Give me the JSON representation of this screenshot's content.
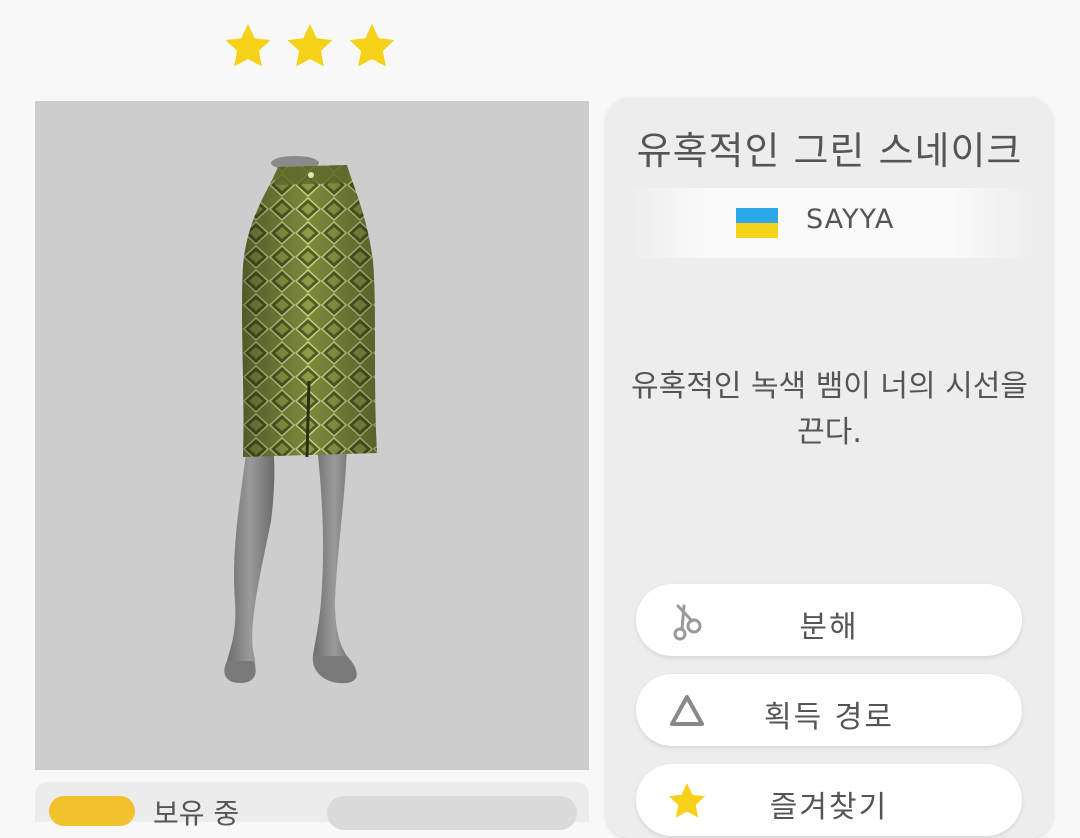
{
  "rating": {
    "stars": 3,
    "star_color": "#f5d117"
  },
  "item": {
    "name": "유혹적인 그린 스네이크",
    "brand": "SAYYA",
    "brand_flag": "ukraine-flag",
    "description": "유혹적인 녹색 뱀이 너의 시선을 끈다.",
    "preview": "green-snake-print-pencil-skirt-on-mannequin"
  },
  "actions": [
    {
      "label": "분해",
      "icon": "scissors-icon"
    },
    {
      "label": "획득 경로",
      "icon": "triangle-icon"
    },
    {
      "label": "즐겨찾기",
      "icon": "star-icon"
    }
  ],
  "owned": {
    "label": "보유 중",
    "badge_color": "#f2c12e"
  },
  "colors": {
    "panel_bg": "#cdcdcd",
    "card_bg": "#ededed",
    "accent": "#f5d117"
  }
}
